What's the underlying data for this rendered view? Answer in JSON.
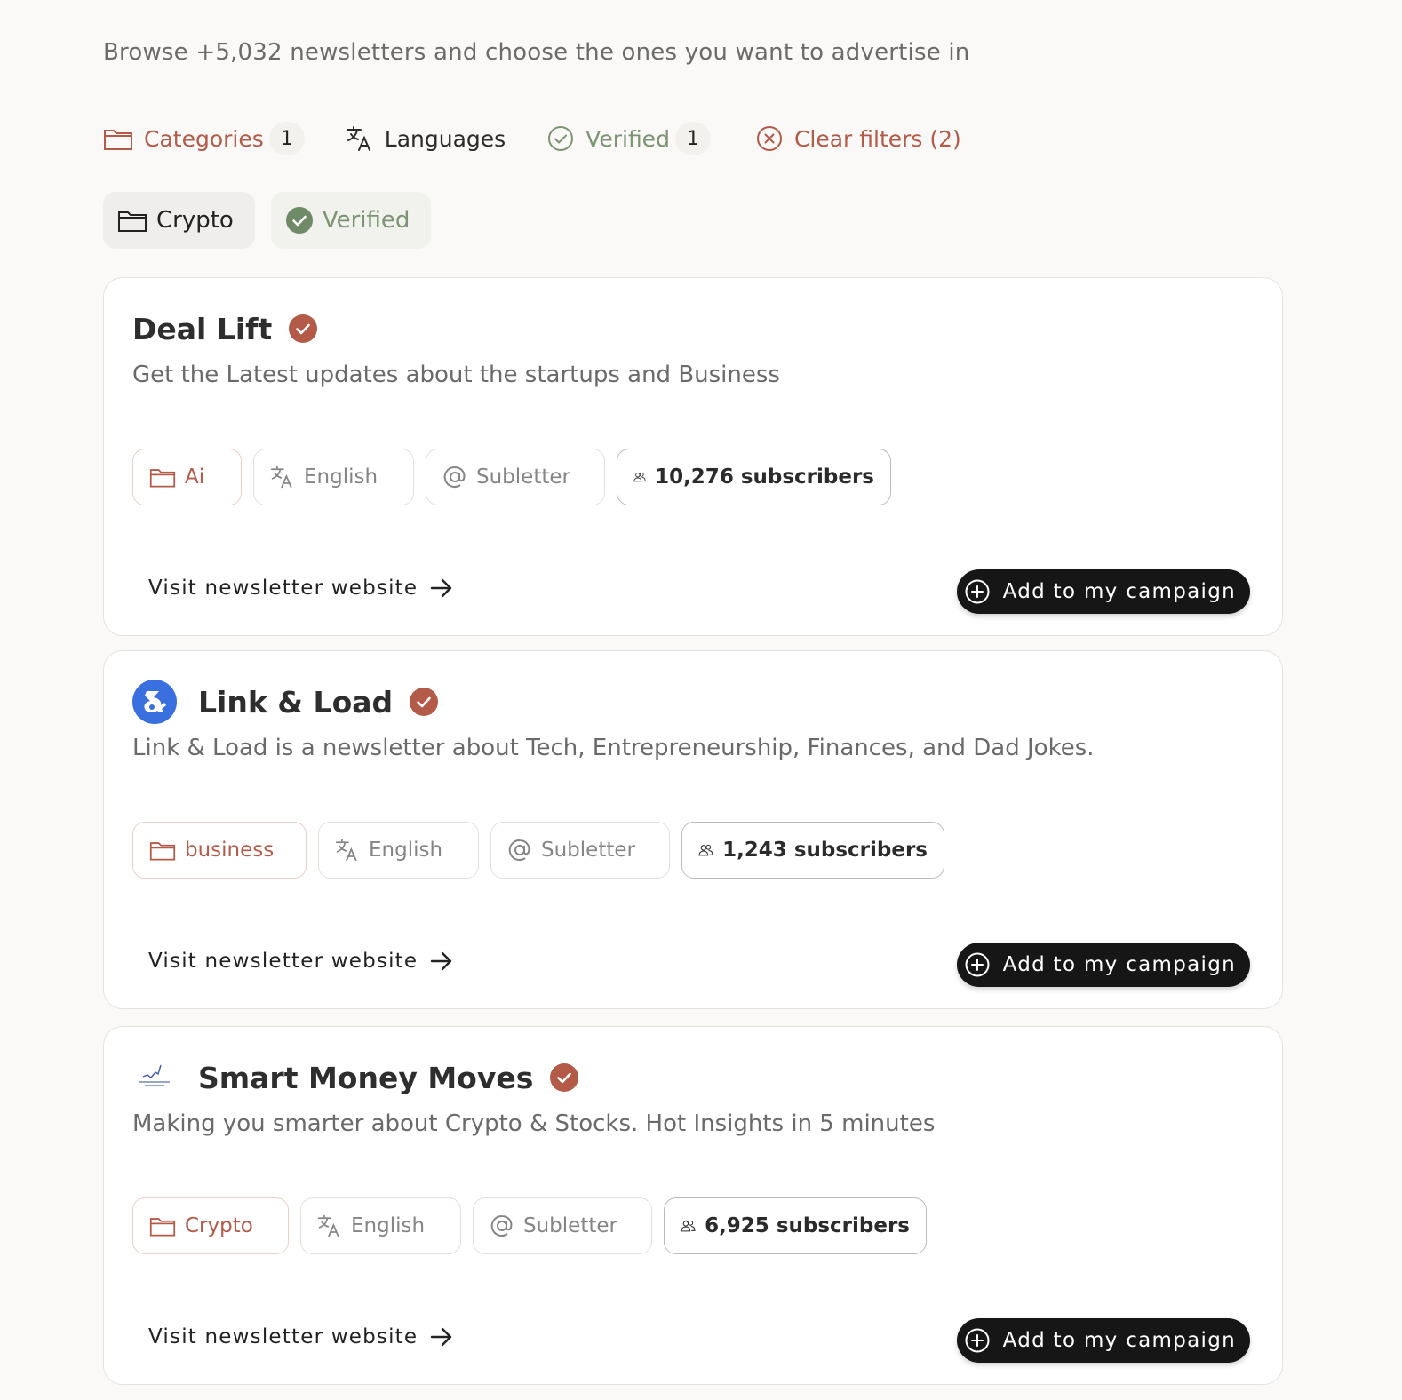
{
  "header": {
    "subtitle": "Browse +5,032 newsletters and choose the ones you want to advertise in"
  },
  "filters": {
    "categories": {
      "label": "Categories",
      "count": "1",
      "icon": "folder-icon"
    },
    "languages": {
      "label": "Languages",
      "icon": "translate-icon"
    },
    "verified": {
      "label": "Verified",
      "count": "1",
      "icon": "check-circle-icon"
    },
    "clear": {
      "label": "Clear filters (2)",
      "icon": "x-circle-icon"
    }
  },
  "active_chips": [
    {
      "label": "Crypto",
      "icon": "folder-icon"
    },
    {
      "label": "Verified",
      "icon": "check-circle-filled-icon"
    }
  ],
  "newsletters": [
    {
      "title": "Deal Lift",
      "verified": true,
      "has_logo": false,
      "description": "Get the Latest updates about the startups and Business",
      "category": "Ai",
      "language": "English",
      "platform": "Subletter",
      "subscribers": "10,276 subscribers",
      "visit_label": "Visit newsletter website",
      "add_label": "Add to my campaign"
    },
    {
      "title": "Link & Load",
      "verified": true,
      "has_logo": true,
      "description": "Link & Load is a newsletter about Tech, Entrepreneurship, Finances, and Dad Jokes.",
      "category": "business",
      "language": "English",
      "platform": "Subletter",
      "subscribers": "1,243 subscribers",
      "visit_label": "Visit newsletter website",
      "add_label": "Add to my campaign"
    },
    {
      "title": "Smart Money Moves",
      "verified": true,
      "has_logo": true,
      "description": "Making you smarter about Crypto & Stocks. Hot Insights in 5 minutes",
      "category": "Crypto",
      "language": "English",
      "platform": "Subletter",
      "subscribers": "6,925 subscribers",
      "visit_label": "Visit newsletter website",
      "add_label": "Add to my campaign"
    }
  ],
  "colors": {
    "accent": "#b35a48",
    "verified_green": "#7c9474",
    "verified_badge": "#b35a48",
    "button_bg": "#161616",
    "page_bg": "#faf9f7"
  }
}
